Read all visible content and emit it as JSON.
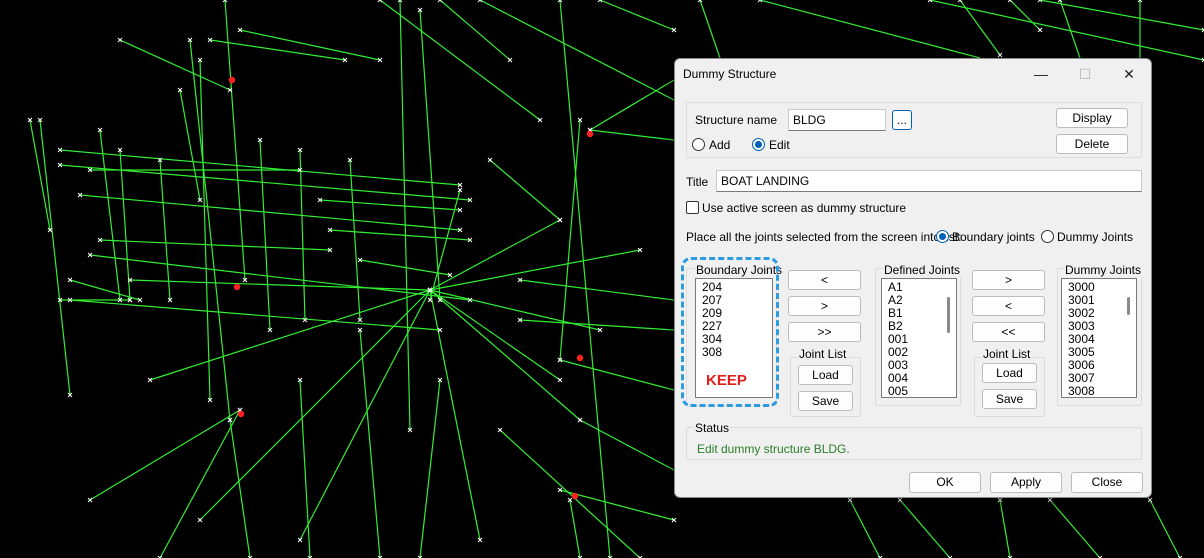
{
  "dialog": {
    "title": "Dummy Structure",
    "window_controls": {
      "minimize": "—",
      "maximize": "☐",
      "close": "✕"
    },
    "structure_name_label": "Structure name",
    "structure_name_value": "BLDG",
    "browse_label": "...",
    "display_label": "Display",
    "delete_label": "Delete",
    "mode_add_label": "Add",
    "mode_edit_label": "Edit",
    "mode_selected": "Edit",
    "title_label": "Title",
    "title_value": "BOAT LANDING",
    "use_active_screen_label": "Use active screen as dummy structure",
    "use_active_screen_checked": false,
    "place_label": "Place all the joints selected from the screen into list:",
    "place_boundary_label": "Boundary joints",
    "place_dummy_label": "Dummy Joints",
    "place_selected": "Boundary joints",
    "boundary": {
      "header": "Boundary Joints",
      "items": [
        "204",
        "207",
        "209",
        "227",
        "304",
        "308"
      ]
    },
    "left_transfer": {
      "left_label": "<",
      "right_label": ">",
      "all_label": ">>"
    },
    "joint_list_left": {
      "label": "Joint List",
      "load_label": "Load",
      "save_label": "Save"
    },
    "defined": {
      "header": "Defined Joints",
      "items": [
        "A1",
        "A2",
        "B1",
        "B2",
        "001",
        "002",
        "003",
        "004",
        "005"
      ]
    },
    "right_transfer": {
      "right_label": ">",
      "left_label": "<",
      "all_label": "<<"
    },
    "joint_list_right": {
      "label": "Joint List",
      "load_label": "Load",
      "save_label": "Save"
    },
    "dummy": {
      "header": "Dummy Joints",
      "items": [
        "3000",
        "3001",
        "3002",
        "3003",
        "3004",
        "3005",
        "3006",
        "3007",
        "3008"
      ]
    },
    "status": {
      "label": "Status",
      "text": "Edit dummy structure BLDG."
    },
    "ok_label": "OK",
    "apply_label": "Apply",
    "close_label": "Close"
  },
  "annotation": {
    "text": "KEEP",
    "color": "#e0221b",
    "highlight_color": "#2d9be0"
  },
  "colors": {
    "wireframe": "#33ee33",
    "node_mark": "#ffffff",
    "node_highlight": "#ff2020",
    "background": "#000000",
    "status_text": "#2a7d2a"
  }
}
